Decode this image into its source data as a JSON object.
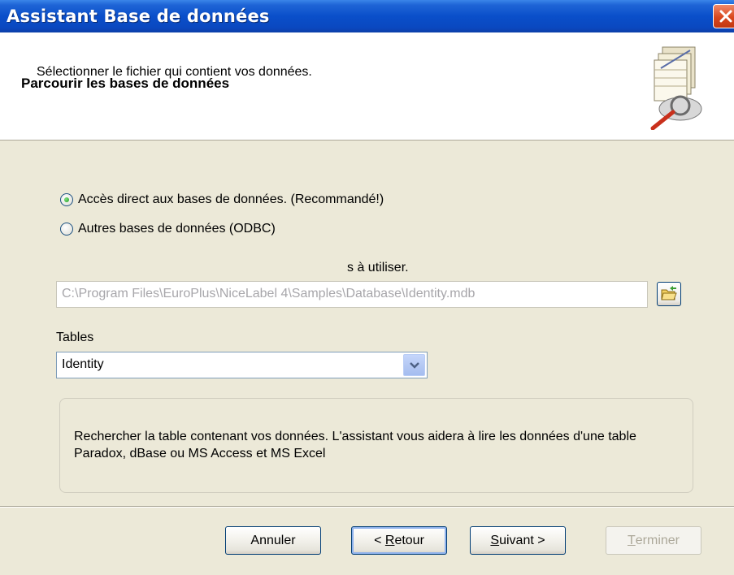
{
  "window": {
    "title": "Assistant Base de données"
  },
  "header": {
    "title": "Parcourir les bases de données",
    "subtitle": "Sélectionner le fichier qui contient vos données."
  },
  "options": {
    "direct": {
      "label": "Accès direct aux bases de données. (Recommandé!)",
      "selected": true
    },
    "odbc": {
      "label": "Autres bases de données (ODBC)",
      "selected": false
    }
  },
  "file": {
    "label": "s à utiliser.",
    "path": "C:\\Program Files\\EuroPlus\\NiceLabel 4\\Samples\\Database\\Identity.mdb"
  },
  "tables": {
    "label": "Tables",
    "selected": "Identity"
  },
  "info": {
    "text": "Rechercher la table contenant vos données. L'assistant vous aidera à lire les données d'une table Paradox, dBase ou MS Access et MS Excel"
  },
  "buttons": {
    "cancel": "Annuler",
    "back_key": "R",
    "back_rest": "etour",
    "back_prefix": "< ",
    "next_key": "S",
    "next_rest": "uivant >",
    "finish_key": "T",
    "finish_rest": "erminer"
  },
  "colors": {
    "titlebar": "#0a4fca",
    "dialog_bg": "#ece9d8",
    "header_bg": "#ffffff"
  }
}
